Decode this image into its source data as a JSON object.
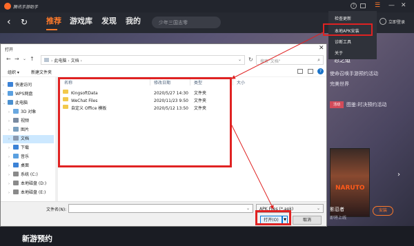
{
  "app": {
    "title": "腾讯手游助手",
    "nav_tabs": [
      "推荐",
      "游戏库",
      "发现",
      "我的"
    ],
    "search_placeholder": "少年三国志零",
    "login_label": "立即登录",
    "accent_color": "#ff7a2a"
  },
  "menu": {
    "items": [
      "检查更新",
      "本地APK安装",
      "诊断工具",
      "关于"
    ],
    "highlighted": "本地APK安装"
  },
  "banner_info": {
    "title": "忍之道",
    "lines": [
      "使命召唤手游预约活动",
      "完美世界",
      "活动",
      "图鉴:时决预约活动"
    ],
    "game_name": "影忍者",
    "game_sub": "即将上线",
    "install_label": "安装",
    "char_text": "NARUTO"
  },
  "section_title": "新游预约",
  "dialog": {
    "title": "打开",
    "address_path": [
      "此电脑",
      "文档"
    ],
    "search_placeholder": "搜索\"文档\"",
    "toolbar": {
      "organize": "组织 ▾",
      "new_folder": "新建文件夹"
    },
    "nav_tree": [
      {
        "label": "快速访问",
        "icon": "star-icon",
        "icon_color": "#3b82d6",
        "level": 0,
        "expand": "›"
      },
      {
        "label": "WPS网盘",
        "icon": "cloud-icon",
        "icon_color": "#5aa0e0",
        "level": 0,
        "expand": "›"
      },
      {
        "label": "此电脑",
        "icon": "computer-icon",
        "icon_color": "#4a90d0",
        "level": 0,
        "expand": "⌄"
      },
      {
        "label": "3D 对象",
        "icon": "cube-icon",
        "icon_color": "#6aa8e0",
        "level": 1,
        "expand": "›"
      },
      {
        "label": "视频",
        "icon": "video-icon",
        "icon_color": "#7a8aa0",
        "level": 1,
        "expand": "›"
      },
      {
        "label": "图片",
        "icon": "picture-icon",
        "icon_color": "#7aa0c0",
        "level": 1,
        "expand": "›"
      },
      {
        "label": "文档",
        "icon": "document-icon",
        "icon_color": "#8a9ab0",
        "level": 1,
        "expand": "›",
        "selected": true
      },
      {
        "label": "下载",
        "icon": "download-icon",
        "icon_color": "#3b82d6",
        "level": 1,
        "expand": "›"
      },
      {
        "label": "音乐",
        "icon": "music-icon",
        "icon_color": "#5aa0e0",
        "level": 1,
        "expand": "›"
      },
      {
        "label": "桌面",
        "icon": "desktop-icon",
        "icon_color": "#3b82d6",
        "level": 1,
        "expand": "›"
      },
      {
        "label": "系统 (C:)",
        "icon": "drive-icon",
        "icon_color": "#8a8a8a",
        "level": 1,
        "expand": "›"
      },
      {
        "label": "本地磁盘 (D:)",
        "icon": "drive-icon",
        "icon_color": "#8a8a8a",
        "level": 1,
        "expand": "›"
      },
      {
        "label": "本地磁盘 (E:)",
        "icon": "drive-icon",
        "icon_color": "#8a8a8a",
        "level": 1,
        "expand": "›"
      }
    ],
    "columns": [
      "名称",
      "修改日期",
      "类型",
      "大小"
    ],
    "files": [
      {
        "name": "KingsoftData",
        "date": "2020/5/27 14:30",
        "type": "文件夹",
        "size": ""
      },
      {
        "name": "WeChat Files",
        "date": "2020/11/23 9:50",
        "type": "文件夹",
        "size": ""
      },
      {
        "name": "自定义 Office 模板",
        "date": "2020/5/12 13:50",
        "type": "文件夹",
        "size": ""
      }
    ],
    "filename_label": "文件名(N):",
    "filename_value": "",
    "filetype_value": "APK Files (*.apk)",
    "open_label": "打开(O)",
    "cancel_label": "取消"
  },
  "annotation_color": "#e02222"
}
